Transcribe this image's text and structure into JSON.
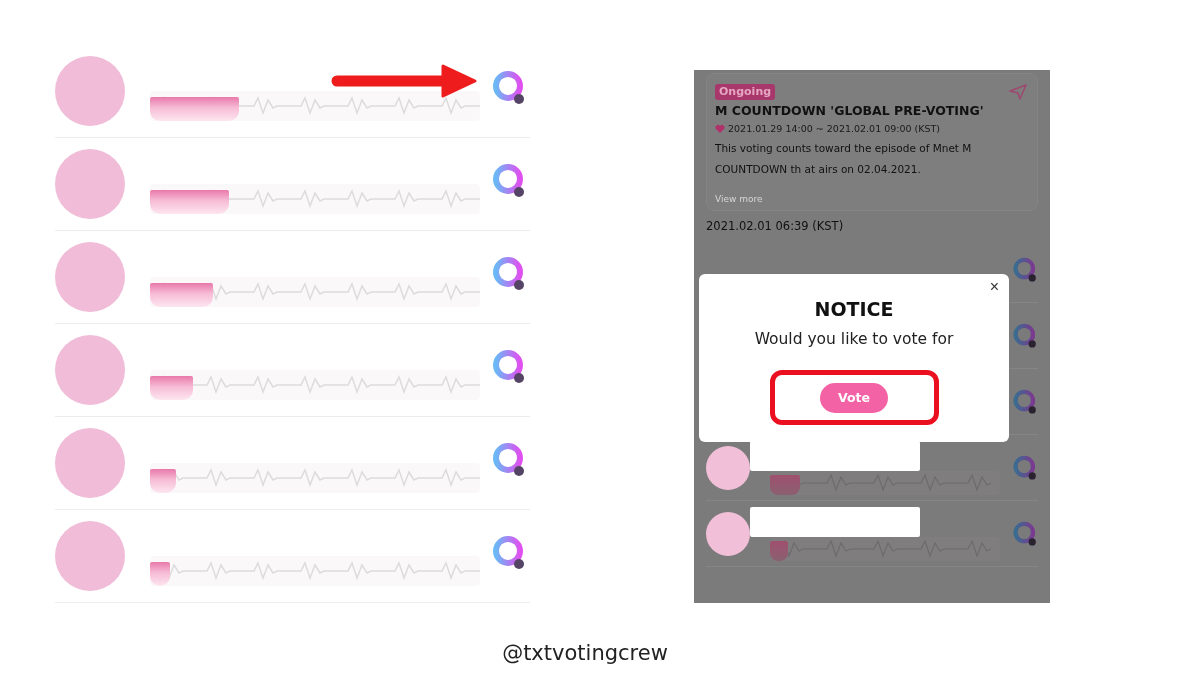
{
  "left_list": {
    "rows": [
      {
        "level": 0.27,
        "pointed": true
      },
      {
        "level": 0.24,
        "pointed": false
      },
      {
        "level": 0.19,
        "pointed": false
      },
      {
        "level": 0.13,
        "pointed": false
      },
      {
        "level": 0.08,
        "pointed": false
      },
      {
        "level": 0.06,
        "pointed": false
      }
    ]
  },
  "phone": {
    "vote_card": {
      "badge": "Ongoing",
      "title": "M COUNTDOWN 'GLOBAL PRE-VOTING'",
      "period": "2021.01.29 14:00 ~ 2021.02.01 09:00 (KST)",
      "description": "This voting counts toward the episode of Mnet M COUNTDOWN th at airs on 02.04.2021.",
      "more_link": "View more"
    },
    "timestamp": "2021.02.01 06:39 (KST)",
    "rows": [
      {
        "kind": "covered"
      },
      {
        "kind": "covered"
      },
      {
        "kind": "covered"
      },
      {
        "kind": "full",
        "level": 0.13
      },
      {
        "kind": "full",
        "level": 0.08
      }
    ],
    "dialog": {
      "title": "NOTICE",
      "message": "Would you like to vote for",
      "button": "Vote",
      "button_highlighted": true,
      "close": "×"
    }
  },
  "footer": "@txtvotingcrew"
}
